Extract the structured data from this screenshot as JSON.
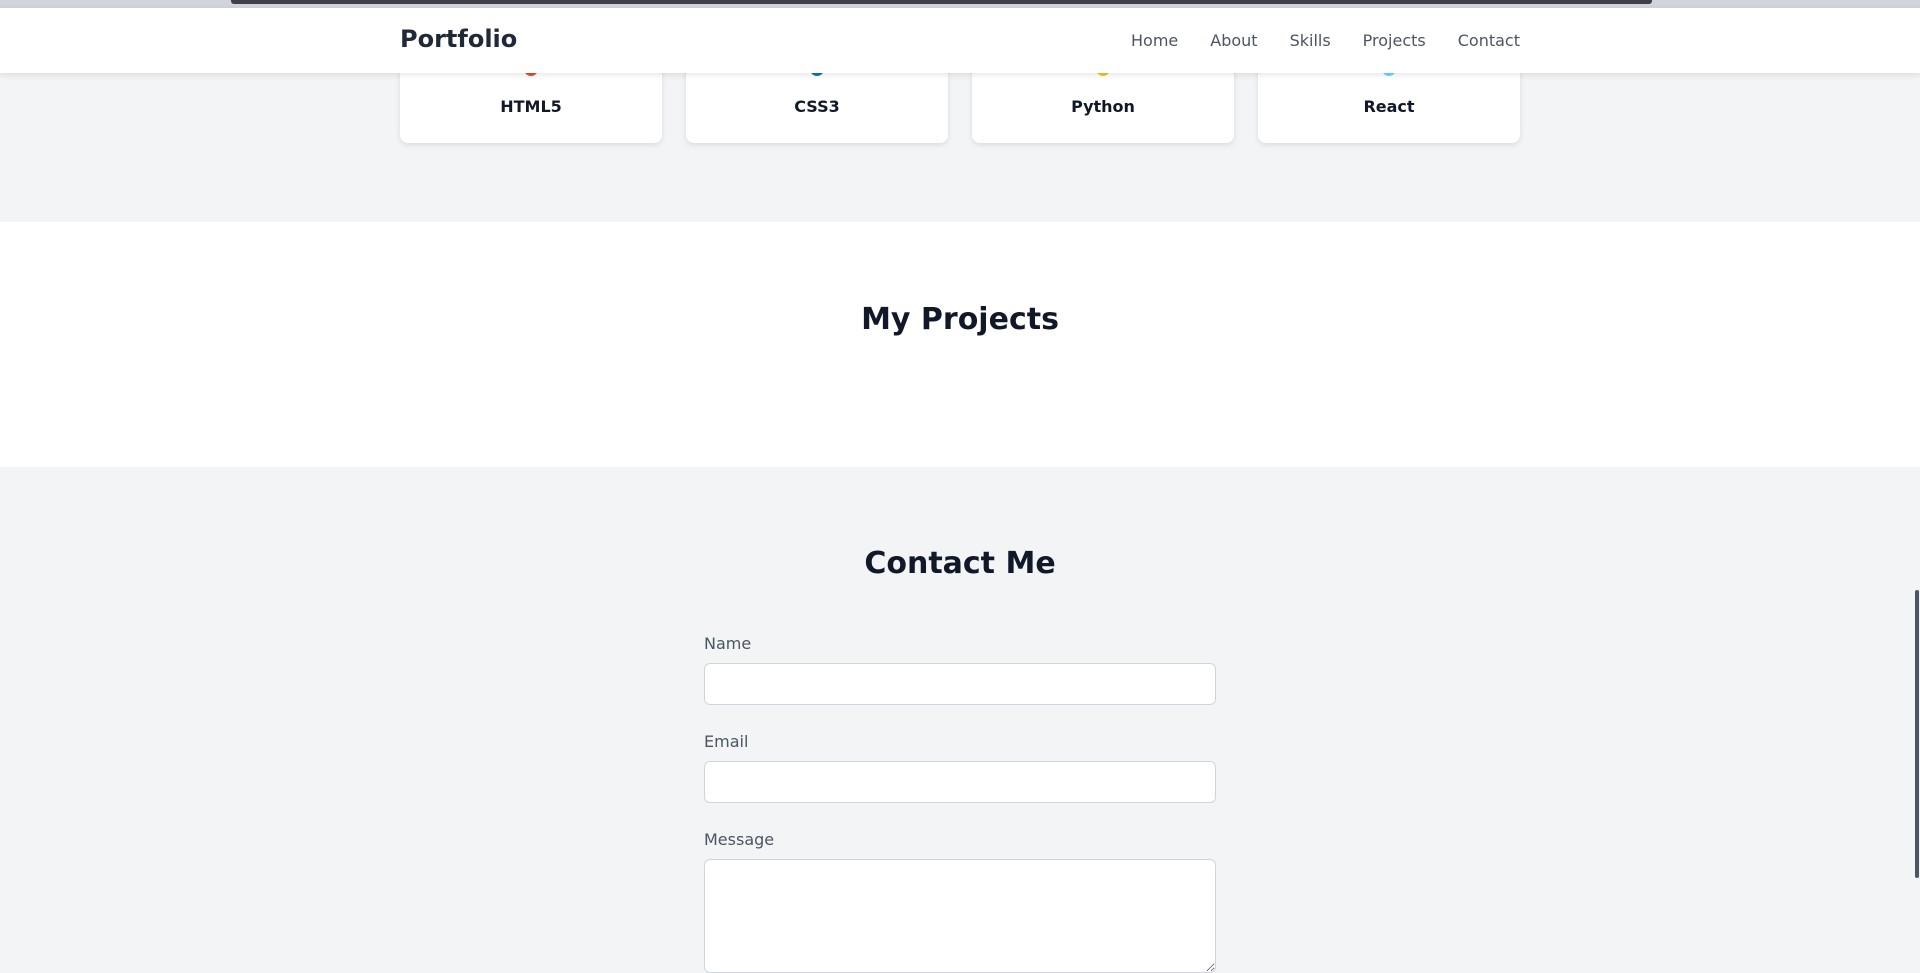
{
  "navbar": {
    "brand": "Portfolio",
    "links": [
      "Home",
      "About",
      "Skills",
      "Projects",
      "Contact"
    ]
  },
  "skills": [
    {
      "name": "HTML5",
      "icon": "html5-icon",
      "color": "#e34f26"
    },
    {
      "name": "CSS3",
      "icon": "css3-icon",
      "color": "#1572b6"
    },
    {
      "name": "Python",
      "icon": "python-icon",
      "color": "#f7c325"
    },
    {
      "name": "React",
      "icon": "react-icon",
      "color": "#61dafb"
    }
  ],
  "projects": {
    "title": "My Projects"
  },
  "contact": {
    "title": "Contact Me",
    "name_label": "Name",
    "name_value": "",
    "email_label": "Email",
    "email_value": "",
    "message_label": "Message",
    "message_value": ""
  },
  "colors": {
    "background": "#f3f4f6",
    "card": "#ffffff",
    "text": "#111827",
    "muted": "#4b5563"
  }
}
